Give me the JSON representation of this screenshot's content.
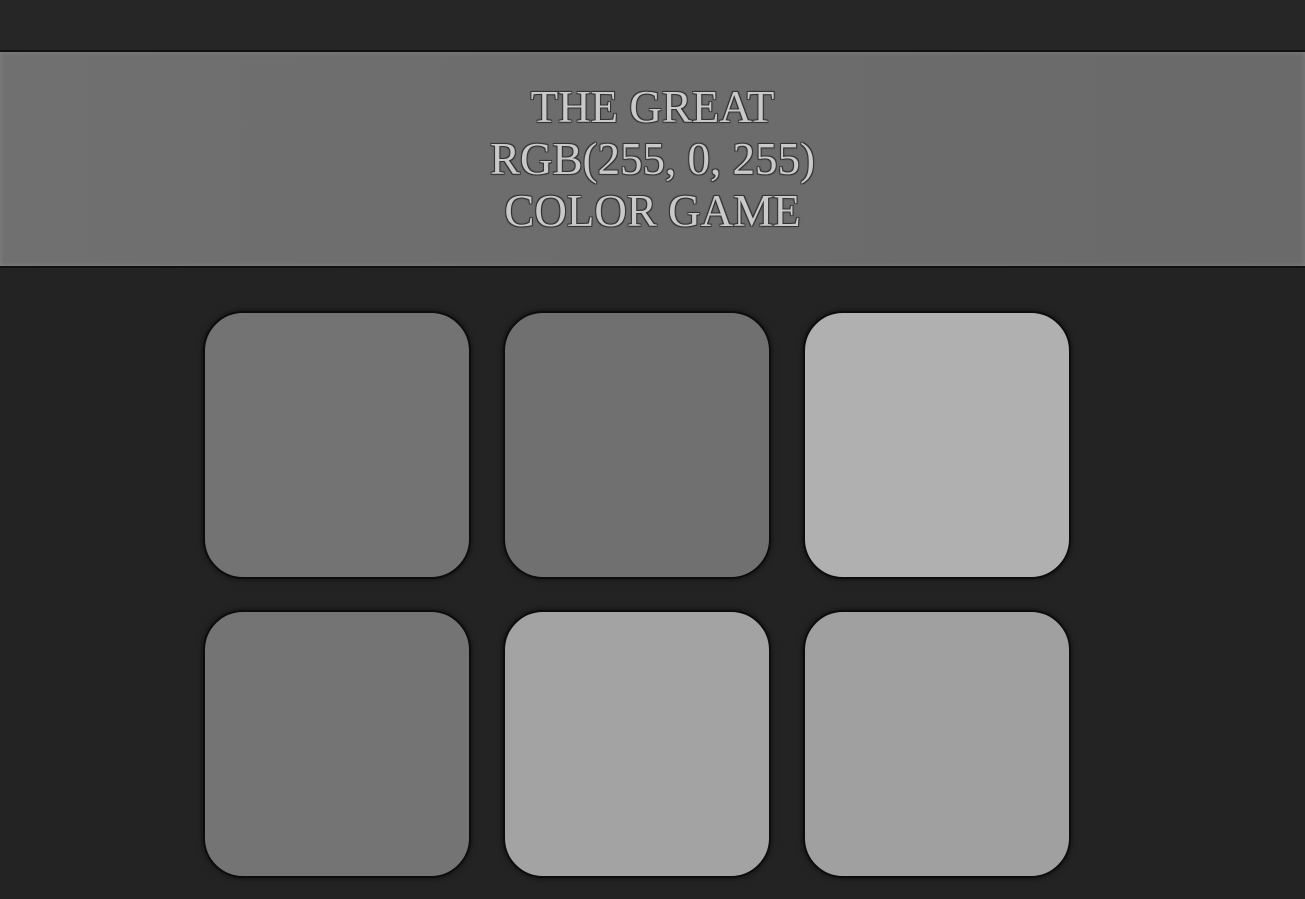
{
  "header": {
    "title_line_1": "THE GREAT",
    "title_line_2": "RGB(255, 0, 255)",
    "title_line_3": "COLOR GAME"
  },
  "colors": {
    "background": "#232323",
    "header_bg": "#6e6e6e",
    "title_text": "#c9c9c9"
  },
  "squares": [
    {
      "color": "#737373"
    },
    {
      "color": "#707070"
    },
    {
      "color": "#b0b0b0"
    },
    {
      "color": "#747474"
    },
    {
      "color": "#a3a3a3"
    },
    {
      "color": "#a0a0a0"
    }
  ]
}
